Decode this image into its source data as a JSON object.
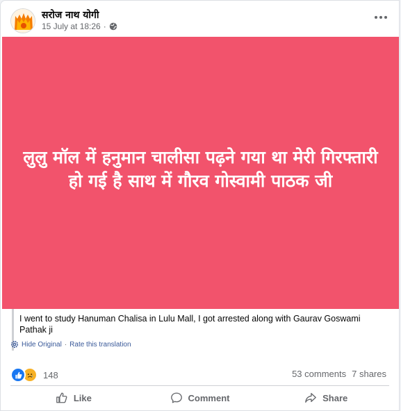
{
  "post": {
    "author": "सरोज नाथ योगी",
    "timestamp": "15 July at 18:26",
    "separator": "·",
    "audience_icon": "globe-icon"
  },
  "banner": {
    "background": "#f2536c",
    "text": "लुलु मॉल में हनुमान चालीसा पढ़ने गया था मेरी गिरफ्तारी हो गई है साथ में गौरव गोस्वामी पाठक जी"
  },
  "translation": {
    "text": "I went to study Hanuman Chalisa in Lulu Mall, I got arrested along with Gaurav Goswami Pathak ji",
    "hide_label": "Hide Original",
    "separator": "·",
    "rate_label": "Rate this translation"
  },
  "stats": {
    "reaction_icons": [
      "like-icon",
      "sad-icon"
    ],
    "reaction_count": "148",
    "comments": "53 comments",
    "shares": "7 shares"
  },
  "actions": {
    "like": "Like",
    "comment": "Comment",
    "share": "Share"
  },
  "colors": {
    "link": "#385898",
    "like_blue": "#1877f2",
    "sad_yellow": "#f7b125"
  }
}
